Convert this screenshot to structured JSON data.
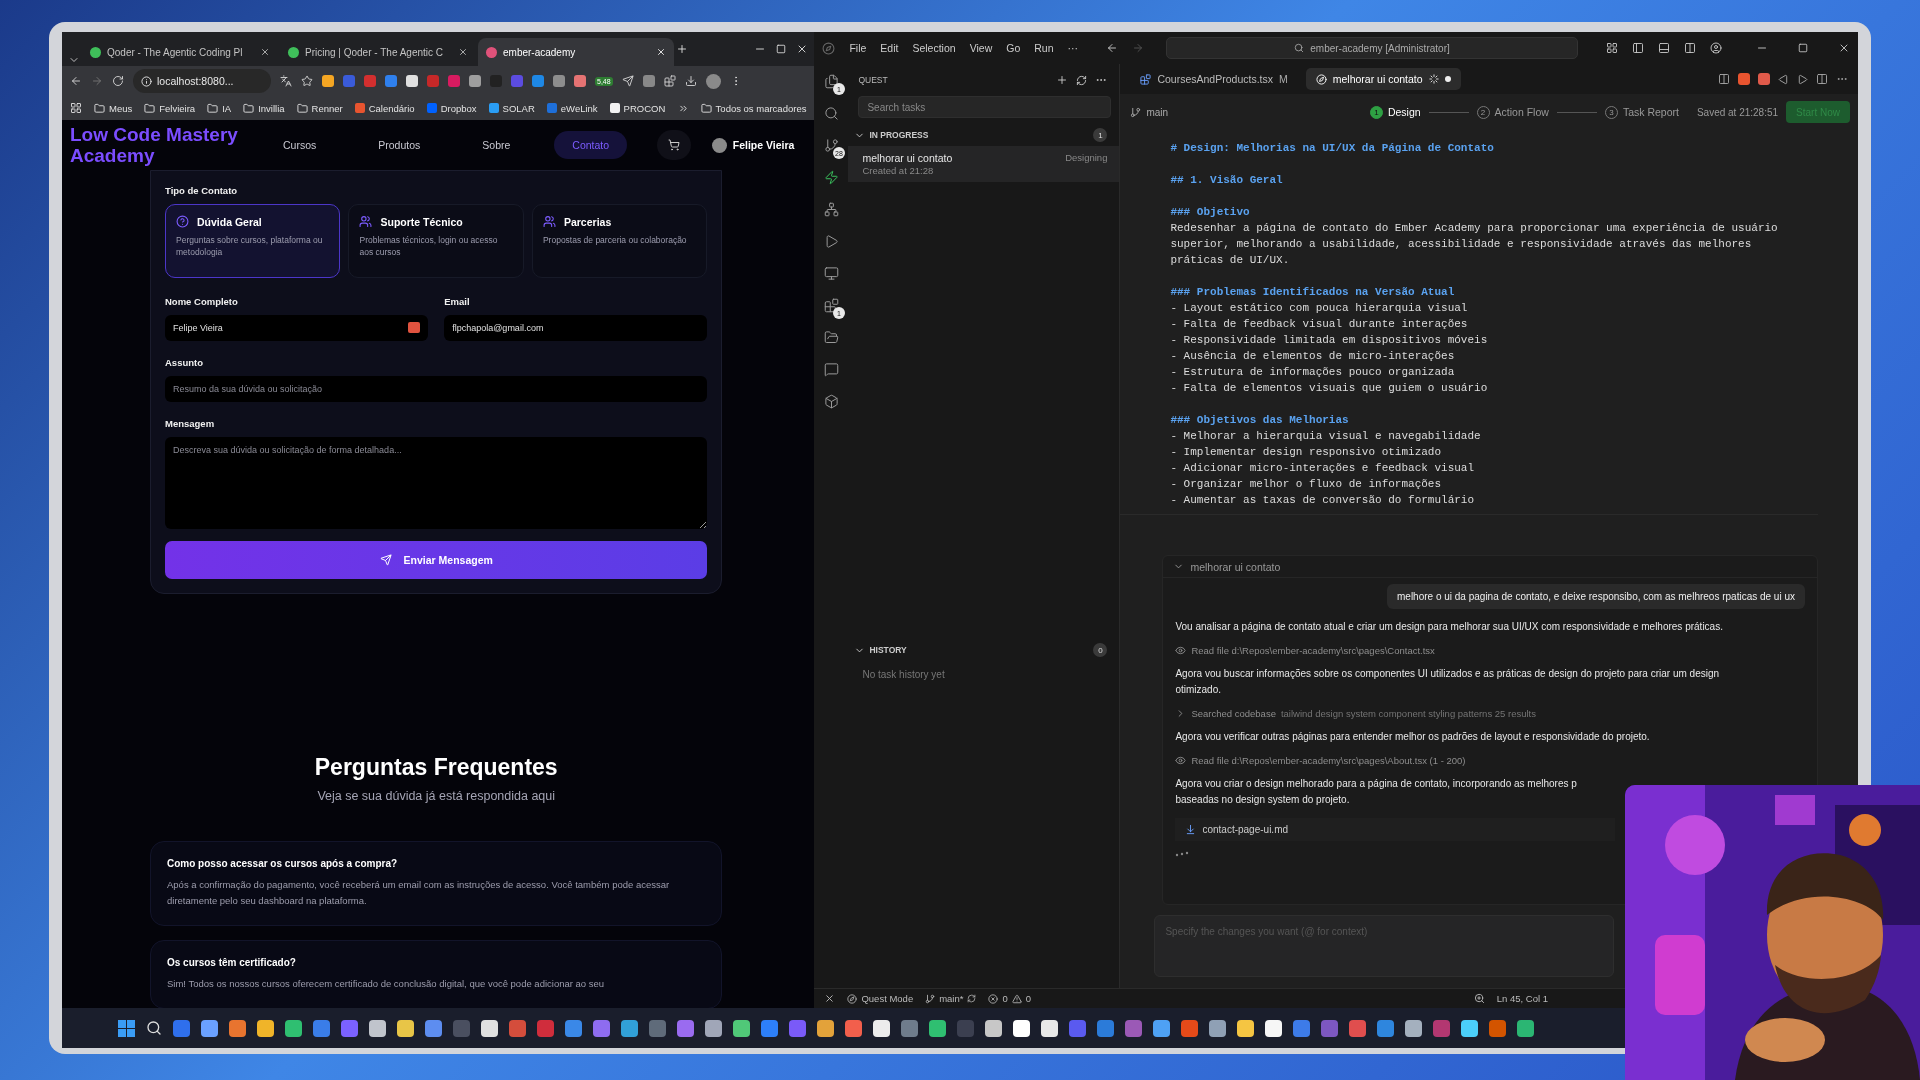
{
  "browser": {
    "tabs": [
      {
        "title": "Qoder - The Agentic Coding Pl",
        "selected": false
      },
      {
        "title": "Pricing | Qoder - The Agentic C",
        "selected": false
      },
      {
        "title": "ember-academy",
        "selected": true
      }
    ],
    "address": "localhost:8080...",
    "extension_badge": "5,48",
    "bookmarks": [
      {
        "label": "Meus",
        "kind": "folder"
      },
      {
        "label": "Felvieira",
        "kind": "folder"
      },
      {
        "label": "IA",
        "kind": "folder"
      },
      {
        "label": "Invillia",
        "kind": "folder"
      },
      {
        "label": "Renner",
        "kind": "folder"
      },
      {
        "label": "Calendário",
        "kind": "site",
        "color": "#e8542f"
      },
      {
        "label": "Dropbox",
        "kind": "site",
        "color": "#0061fe"
      },
      {
        "label": "SOLAR",
        "kind": "site",
        "color": "#2a9df4"
      },
      {
        "label": "eWeLink",
        "kind": "site",
        "color": "#1e6fd9"
      },
      {
        "label": "PROCON",
        "kind": "site",
        "color": "#f2f2f2"
      }
    ],
    "all_bookmarks": "Todos os marcadores",
    "site": {
      "logo": "Low Code Mastery Academy",
      "nav": [
        {
          "label": "Cursos",
          "selected": false
        },
        {
          "label": "Produtos",
          "selected": false
        },
        {
          "label": "Sobre",
          "selected": false
        },
        {
          "label": "Contato",
          "selected": true
        }
      ],
      "user": "Felipe Vieira",
      "form": {
        "type_label": "Tipo de Contato",
        "types": [
          {
            "title": "Dúvida Geral",
            "description": "Perguntas sobre cursos, plataforma ou metodologia",
            "kind": "question",
            "selected": true
          },
          {
            "title": "Suporte Técnico",
            "description": "Problemas técnicos, login ou acesso aos cursos",
            "kind": "people",
            "selected": false
          },
          {
            "title": "Parcerias",
            "description": "Propostas de parceria ou colaboração",
            "kind": "people",
            "selected": false
          }
        ],
        "fields": [
          {
            "label": "Nome Completo",
            "value": "Felipe Vieira",
            "autofill": true
          },
          {
            "label": "Email",
            "value": "flpchapola@gmail.com",
            "autofill": false
          }
        ],
        "subject": {
          "label": "Assunto",
          "placeholder": "Resumo da sua dúvida ou solicitação"
        },
        "message": {
          "label": "Mensagem",
          "placeholder": "Descreva sua dúvida ou solicitação de forma detalhada..."
        },
        "submit": "Enviar Mensagem"
      },
      "faq": {
        "title": "Perguntas Frequentes",
        "subtitle": "Veja se sua dúvida já está respondida aqui",
        "items": [
          {
            "question": "Como posso acessar os cursos após a compra?",
            "answer": "Após a confirmação do pagamento, você receberá um email com as instruções de acesso. Você também pode acessar diretamente pelo seu dashboard na plataforma."
          },
          {
            "question": "Os cursos têm certificado?",
            "answer": "Sim! Todos os nossos cursos oferecem certificado de conclusão digital, que você pode adicionar ao seu"
          }
        ]
      }
    }
  },
  "ide": {
    "menu": [
      "File",
      "Edit",
      "Selection",
      "View",
      "Go",
      "Run",
      "···"
    ],
    "command_center": "ember-academy [Administrator]",
    "activity": [
      {
        "kind": "files",
        "badge": "1",
        "selected": false
      },
      {
        "kind": "search",
        "selected": false
      },
      {
        "kind": "git",
        "badge": "28",
        "selected": false
      },
      {
        "kind": "quest",
        "selected": true
      },
      {
        "kind": "agents",
        "selected": false
      },
      {
        "kind": "run",
        "selected": false
      },
      {
        "kind": "remote",
        "selected": false
      },
      {
        "kind": "extensions",
        "badge": "1",
        "selected": false
      },
      {
        "kind": "folder",
        "selected": false
      },
      {
        "kind": "chat",
        "selected": false
      },
      {
        "kind": "box",
        "selected": false
      }
    ],
    "quest": {
      "title": "QUEST",
      "search_placeholder": "Search tasks",
      "in_progress": {
        "label": "IN PROGRESS",
        "count": "1",
        "expanded": true,
        "tasks": [
          {
            "title": "melhorar ui contato",
            "status": "Designing",
            "created": "Created at 21:28",
            "selected": true
          }
        ]
      },
      "history": {
        "label": "HISTORY",
        "count": "0",
        "expanded": true,
        "empty": "No task history yet"
      }
    },
    "editor_tabs": [
      {
        "label": "CoursesAndProducts.tsx",
        "badge": "M",
        "selected": false
      },
      {
        "label": "melhorar ui contato",
        "selected": true
      }
    ],
    "branch": "main",
    "steps": [
      {
        "number": "1",
        "label": "Design",
        "selected": true
      },
      {
        "number": "2",
        "label": "Action Flow",
        "selected": false
      },
      {
        "number": "3",
        "label": "Task Report",
        "selected": false
      }
    ],
    "saved": "Saved at 21:28:51",
    "start": "Start Now",
    "document": [
      {
        "kind": "heading",
        "text": "# Design: Melhorias na UI/UX da Página de Contato"
      },
      {
        "kind": "heading",
        "text": "## 1. Visão Geral"
      },
      {
        "kind": "heading",
        "text": "### Objetivo"
      },
      {
        "kind": "text",
        "text": "Redesenhar a página de contato do Ember Academy para proporcionar uma experiência de usuário"
      },
      {
        "kind": "text",
        "text": "superior, melhorando a usabilidade, acessibilidade e responsividade através das melhores"
      },
      {
        "kind": "text",
        "text": "práticas de UI/UX."
      },
      {
        "kind": "heading",
        "text": "### Problemas Identificados na Versão Atual"
      },
      {
        "kind": "text",
        "text": "- Layout estático com pouca hierarquia visual"
      },
      {
        "kind": "text",
        "text": "- Falta de feedback visual durante interações"
      },
      {
        "kind": "text",
        "text": "- Responsividade limitada em dispositivos móveis"
      },
      {
        "kind": "text",
        "text": "- Ausência de elementos de micro-interações"
      },
      {
        "kind": "text",
        "text": "- Estrutura de informações pouco organizada"
      },
      {
        "kind": "text",
        "text": "- Falta de elementos visuais que guiem o usuário"
      },
      {
        "kind": "heading",
        "text": "### Objetivos das Melhorias"
      },
      {
        "kind": "text",
        "text": "- Melhorar a hierarquia visual e navegabilidade"
      },
      {
        "kind": "text",
        "text": "- Implementar design responsivo otimizado"
      },
      {
        "kind": "text",
        "text": "- Adicionar micro-interações e feedback visual"
      },
      {
        "kind": "text",
        "text": "- Organizar melhor o fluxo de informações"
      },
      {
        "kind": "text",
        "text": "- Aumentar as taxas de conversão do formulário"
      }
    ],
    "chat": {
      "title": "melhorar ui contato",
      "expanded": true,
      "user_message": "melhore o ui da pagina de contato, e deixe responsibo, com as melhreos rpaticas de ui ux",
      "entries": [
        {
          "kind": "text",
          "lines": [
            "Vou analisar a página de contato atual e criar um design para melhorar sua UI/UX com responsividade e melhores práticas."
          ]
        },
        {
          "kind": "read",
          "label": "Read file d:\\Repos\\ember-academy\\src\\pages\\Contact.tsx"
        },
        {
          "kind": "text",
          "lines": [
            "Agora vou buscar informações sobre os componentes UI utilizados e as práticas de design do projeto para criar um design",
            "otimizado."
          ]
        },
        {
          "kind": "search",
          "label": "Searched codebase",
          "detail": "tailwind design system component styling patterns 25 results"
        },
        {
          "kind": "text",
          "lines": [
            "Agora vou verificar outras páginas para entender melhor os padrões de layout e responsividade do projeto."
          ]
        },
        {
          "kind": "read",
          "label": "Read file d:\\Repos\\ember-academy\\src\\pages\\About.tsx (1 - 200)"
        },
        {
          "kind": "text",
          "lines": [
            "Agora vou criar o design melhorado para a página de contato, incorporando as melhores p",
            "baseadas no design system do projeto."
          ]
        },
        {
          "kind": "file",
          "label": "contact-page-ui.md"
        }
      ],
      "input_placeholder": "Specify the changes you want (@ for context)"
    },
    "status": {
      "mode": "Quest Mode",
      "branch": "main*",
      "errors": "0",
      "warnings": "0",
      "position": "Ln 45, Col 1"
    }
  }
}
